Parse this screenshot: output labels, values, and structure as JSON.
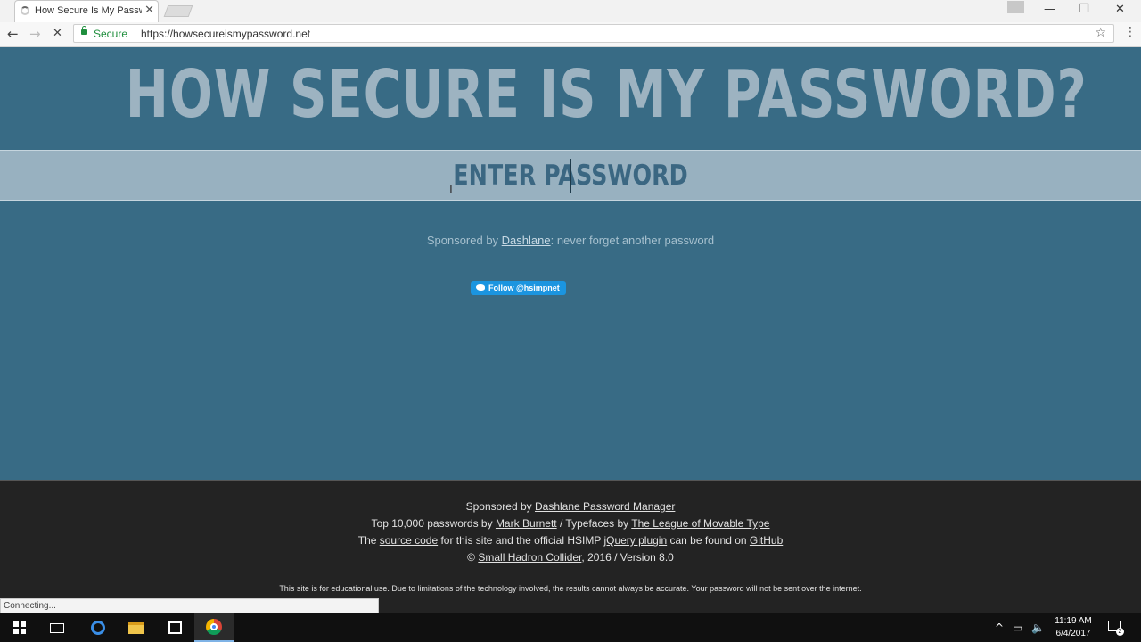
{
  "browser": {
    "tab_title": "How Secure Is My Password?",
    "tab_close": "✕",
    "window_controls": {
      "minimize": "—",
      "restore": "❐",
      "close": "✕"
    },
    "nav": {
      "back": "←",
      "forward": "→",
      "reload": "✕"
    },
    "secure_label": "Secure",
    "url": "https://howsecureismypassword.net",
    "bookmark_icon": "☆",
    "menu_icon": "⋮"
  },
  "page": {
    "title": "HOW SECURE IS MY PASSWORD?",
    "password_placeholder": "ENTER PASSWORD",
    "sponsor_prefix": "Sponsored by ",
    "sponsor_link": "Dashlane",
    "sponsor_suffix": ": never forget another password",
    "follow_button": "Follow @hsimpnet"
  },
  "footer": {
    "line1": {
      "prefix": "Sponsored by ",
      "link": "Dashlane Password Manager"
    },
    "line2": {
      "prefix": "Top 10,000 passwords by ",
      "link1": "Mark Burnett",
      "middle": " / Typefaces by ",
      "link2": "The League of Movable Type"
    },
    "line3": {
      "prefix": "The ",
      "link1": "source code",
      "middle1": " for this site and the official HSIMP ",
      "link2": "jQuery plugin",
      "middle2": " can be found on ",
      "link3": "GitHub"
    },
    "line4": {
      "prefix": "© ",
      "link": "Small Hadron Collider",
      "suffix": ", 2016 / Version 8.0"
    },
    "disclaimer": "This site is for educational use. Due to limitations of the technology involved, the results cannot always be accurate. Your password will not be sent over the internet."
  },
  "status_bar": "Connecting...",
  "taskbar": {
    "time": "11:19 AM",
    "date": "6/4/2017",
    "notification_count": "2"
  },
  "colors": {
    "page_background": "#386b85",
    "title_text": "#9db3c1",
    "password_band": "#98b1c0",
    "footer_background": "#232323",
    "twitter_blue": "#1b95e0"
  }
}
